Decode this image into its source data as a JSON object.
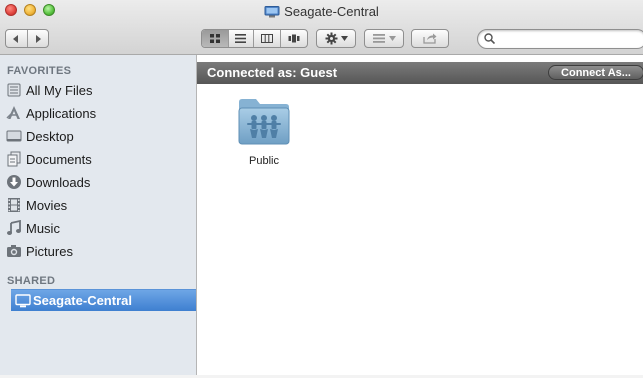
{
  "window": {
    "title": "Seagate-Central"
  },
  "toolbar": {
    "view_icons": [
      "icon-view-icon",
      "list-view-icon",
      "column-view-icon",
      "coverflow-view-icon"
    ],
    "search": {
      "value": "",
      "placeholder": ""
    }
  },
  "sidebar": {
    "favorites_header": "FAVORITES",
    "favorites": [
      {
        "label": "All My Files",
        "icon": "all-my-files-icon"
      },
      {
        "label": "Applications",
        "icon": "applications-icon"
      },
      {
        "label": "Desktop",
        "icon": "desktop-icon"
      },
      {
        "label": "Documents",
        "icon": "documents-icon"
      },
      {
        "label": "Downloads",
        "icon": "downloads-icon"
      },
      {
        "label": "Movies",
        "icon": "movies-icon"
      },
      {
        "label": "Music",
        "icon": "music-icon"
      },
      {
        "label": "Pictures",
        "icon": "pictures-icon"
      }
    ],
    "shared_header": "SHARED",
    "shared": [
      {
        "label": "Seagate-Central",
        "icon": "network-computer-icon",
        "selected": true
      }
    ]
  },
  "content": {
    "connected_label": "Connected as: Guest",
    "connect_button": "Connect As...",
    "items": [
      {
        "label": "Public",
        "icon": "shared-folder-icon"
      }
    ]
  },
  "colors": {
    "selection": "#3e7fd0",
    "sidebar_bg": "#e3e8ee",
    "connect_bar": "#5e5e5e",
    "folder": "#8fb9d8"
  }
}
